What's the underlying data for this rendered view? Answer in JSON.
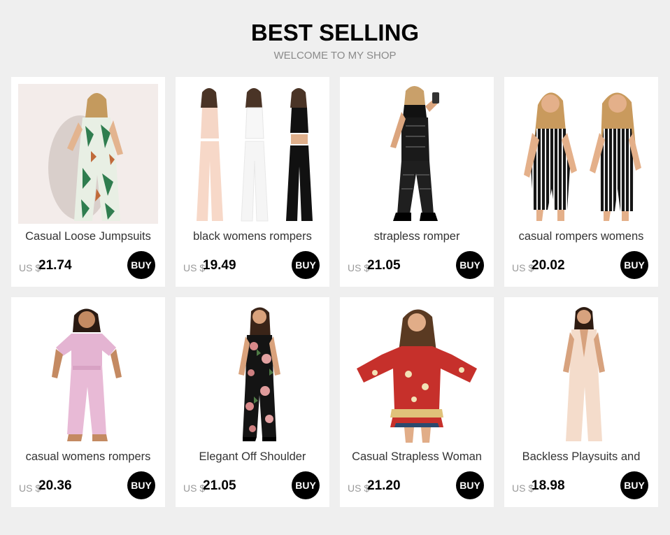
{
  "header": {
    "title": "BEST SELLING",
    "subtitle": "WELCOME TO MY SHOP"
  },
  "colors": {
    "background": "#efefef",
    "card": "#ffffff",
    "buy_button": "#000000",
    "price": "#000000",
    "currency": "#999999"
  },
  "products": [
    {
      "name": "Casual Loose Jumpsuits",
      "currency": "US $",
      "price": "21.74",
      "buy_label": "BUY"
    },
    {
      "name": "black womens rompers",
      "currency": "US $",
      "price": "19.49",
      "buy_label": "BUY"
    },
    {
      "name": "strapless romper",
      "currency": "US $",
      "price": "21.05",
      "buy_label": "BUY"
    },
    {
      "name": "casual rompers womens",
      "currency": "US $",
      "price": "20.02",
      "buy_label": "BUY"
    },
    {
      "name": "casual womens rompers",
      "currency": "US $",
      "price": "20.36",
      "buy_label": "BUY"
    },
    {
      "name": "Elegant Off Shoulder",
      "currency": "US $",
      "price": "21.05",
      "buy_label": "BUY"
    },
    {
      "name": "Casual Strapless Woman",
      "currency": "US $",
      "price": "21.20",
      "buy_label": "BUY"
    },
    {
      "name": "Backless Playsuits and",
      "currency": "US $",
      "price": "18.98",
      "buy_label": "BUY"
    }
  ]
}
